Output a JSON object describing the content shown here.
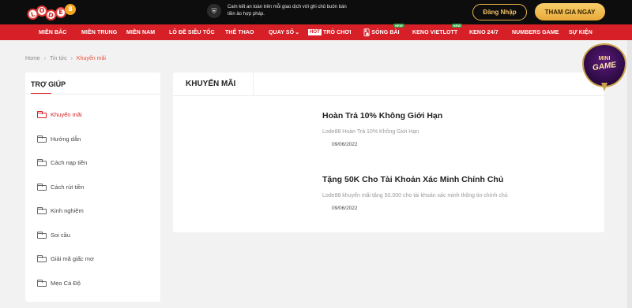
{
  "logo": {
    "letters": [
      "L",
      "O",
      "D",
      "E",
      "8"
    ]
  },
  "safety": {
    "text": "Cam kết an toàn trên mỗi giao dịch với ghi chủ buôn bán tiền ảo hợp pháp."
  },
  "header": {
    "login_label": "Đăng Nhập",
    "join_label": "THAM GIA NGAY"
  },
  "nav": {
    "items": [
      {
        "label": "MIỀN BẮC"
      },
      {
        "label": "MIỀN TRUNG"
      },
      {
        "label": "MIỀN NAM"
      },
      {
        "label": "LÔ ĐỀ SIÊU TỐC"
      },
      {
        "label": "THỂ THAO"
      },
      {
        "label": "QUAY SỐ"
      },
      {
        "label": "TRÒ CHƠI",
        "badge": "HOT"
      },
      {
        "label": "SÒNG BÀI",
        "badge": "NEW"
      },
      {
        "label": "KENO VIETLOTT",
        "badge": "NEW"
      },
      {
        "label": "KENO 24/7"
      },
      {
        "label": "NUMBERS GAME"
      },
      {
        "label": "SỰ KIỆN"
      }
    ]
  },
  "breadcrumb": {
    "home": "Home",
    "section": "Tin tức",
    "current": "Khuyến mãi"
  },
  "sidebar": {
    "title": "TRỢ GIÚP",
    "items": [
      {
        "label": "Khuyến mãi"
      },
      {
        "label": "Hướng dẫn"
      },
      {
        "label": "Cách nạp tiền"
      },
      {
        "label": "Cách rút tiền"
      },
      {
        "label": "Kinh nghiệm"
      },
      {
        "label": "Soi cầu"
      },
      {
        "label": "Giải mã giấc mơ"
      },
      {
        "label": "Mẹo Cá Độ"
      }
    ]
  },
  "main": {
    "title": "KHUYẾN MÃI",
    "articles": [
      {
        "title": "Hoàn Trả 10% Không Giới Hạn",
        "desc": "Lode88 Hoàn Trả 10% Không Giới Hạn",
        "date": "09/06/2022"
      },
      {
        "title": "Tặng 50K Cho Tài Khoản Xác Minh Chính Chủ",
        "desc": "Lode88 khuyến mãi tặng 50.000 cho tài khoản xác minh thông tin chính chủ",
        "date": "09/06/2022"
      }
    ]
  },
  "minigame": {
    "line1": "MINI",
    "line2": "GAME"
  }
}
